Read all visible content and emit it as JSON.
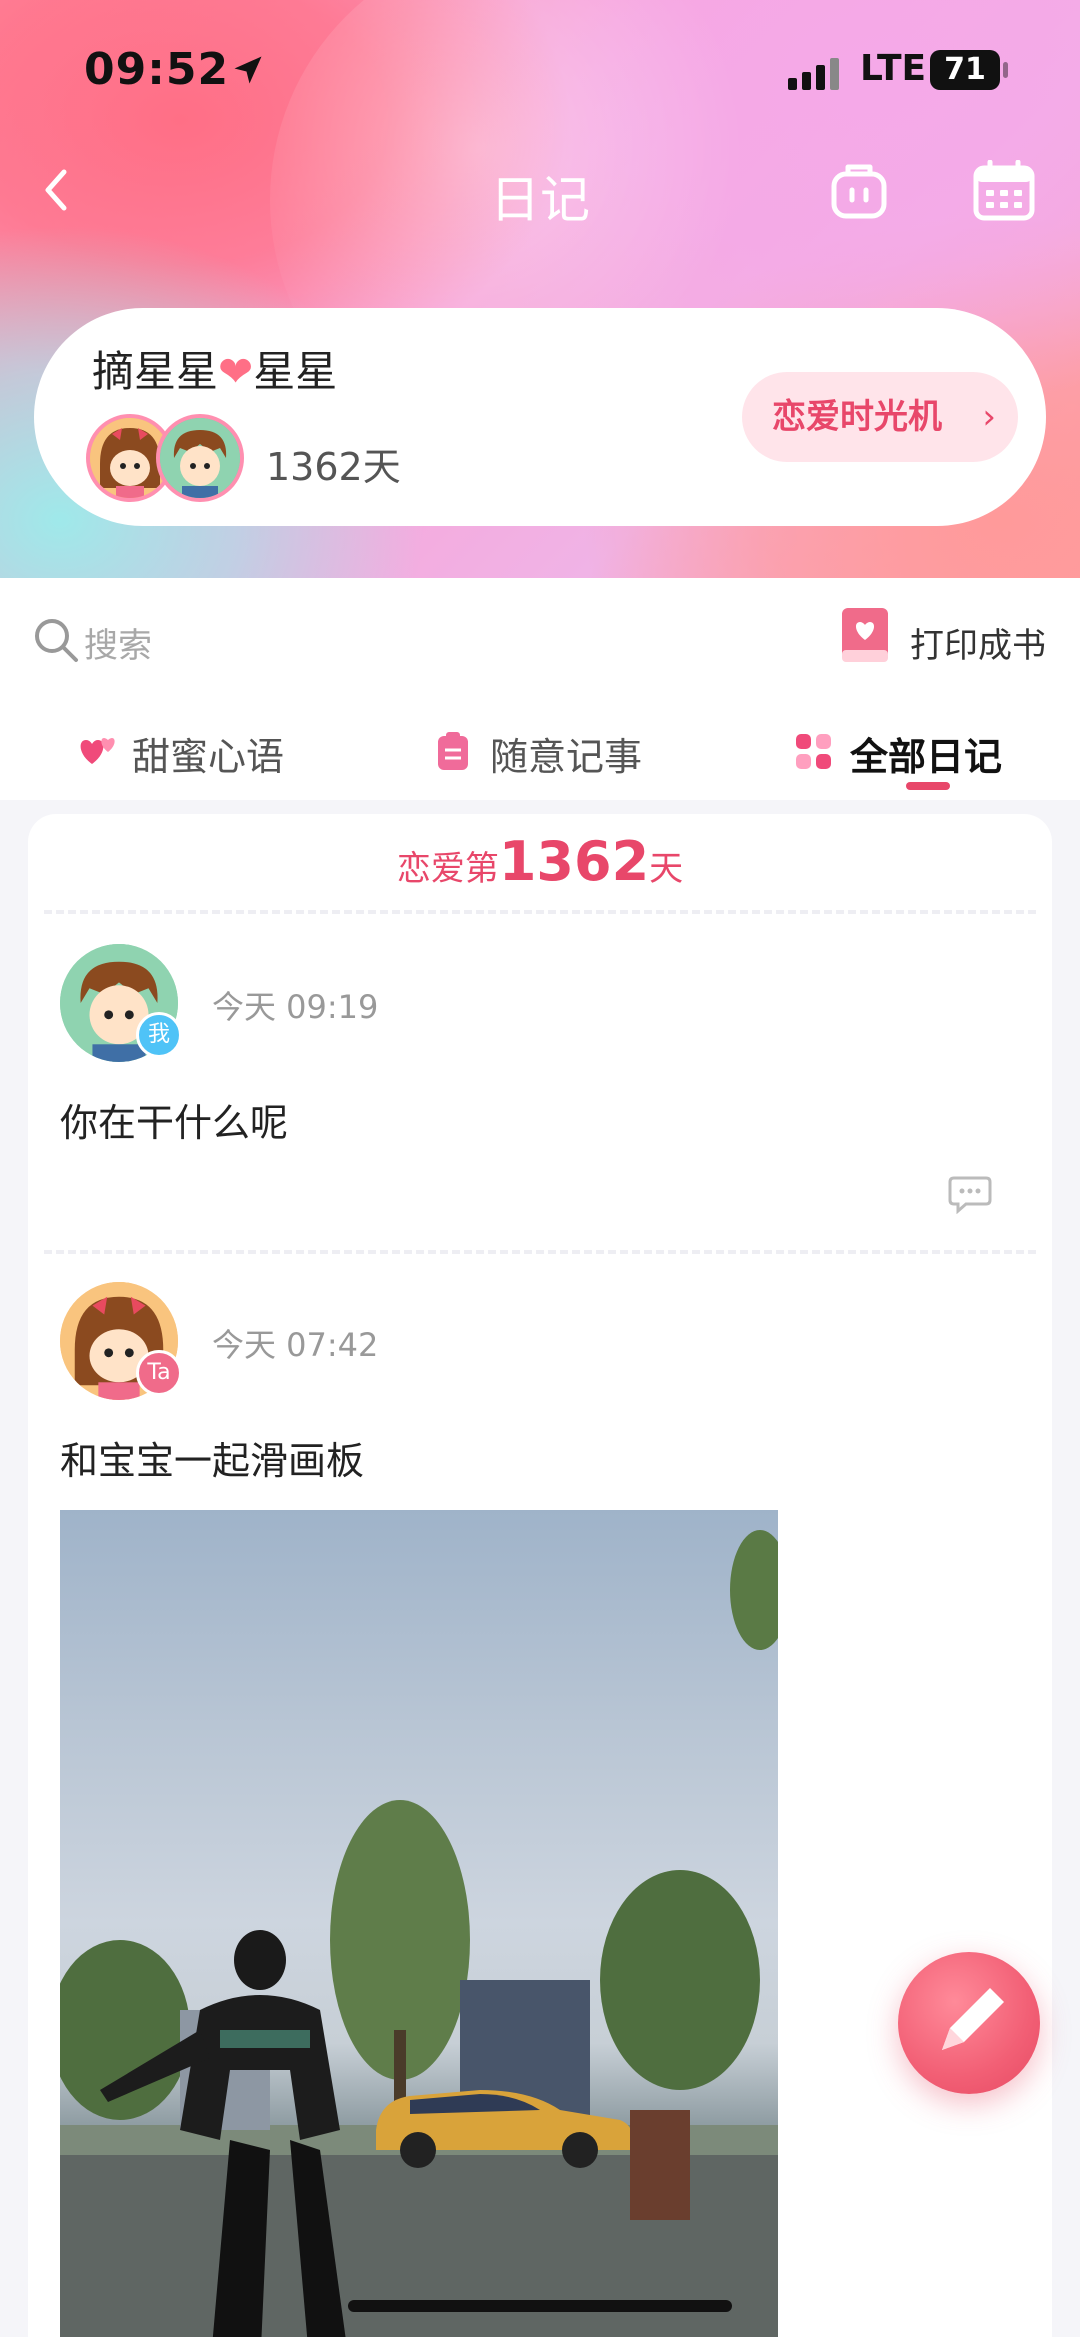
{
  "status_bar": {
    "time": "09:52",
    "network": "LTE",
    "battery": "71"
  },
  "nav": {
    "title": "日记"
  },
  "couple": {
    "name_left": "摘星星",
    "name_right": "星星",
    "days": "1362天",
    "time_machine_label": "恋爱时光机"
  },
  "search": {
    "placeholder": "搜索"
  },
  "print_label": "打印成书",
  "tabs": [
    {
      "label": "甜蜜心语",
      "active": false
    },
    {
      "label": "随意记事",
      "active": false
    },
    {
      "label": "全部日记",
      "active": true
    }
  ],
  "feed": {
    "love_prefix": "恋爱第",
    "love_days": "1362",
    "love_suffix": "天",
    "entries": [
      {
        "badge": "我",
        "time": "今天 09:19",
        "text": "你在干什么呢"
      },
      {
        "badge": "Ta",
        "time": "今天 07:42",
        "text": "和宝宝一起滑画板"
      }
    ]
  },
  "colors": {
    "accent": "#e8476a",
    "badge_me": "#4fc3f7",
    "badge_ta": "#f06b8a"
  }
}
